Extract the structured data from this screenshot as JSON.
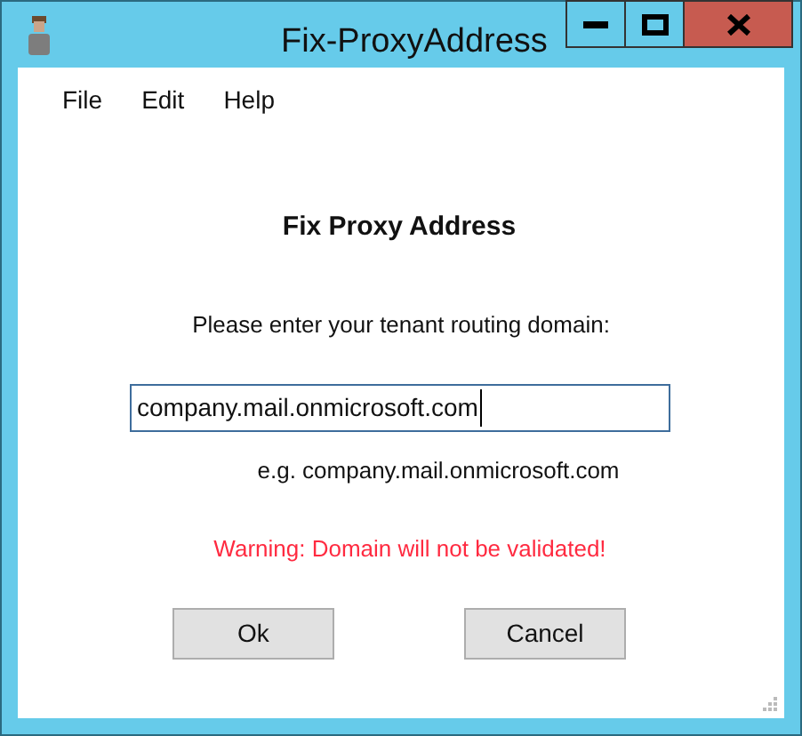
{
  "window": {
    "title": "Fix-ProxyAddress"
  },
  "menu": [
    "File",
    "Edit",
    "Help"
  ],
  "heading": "Fix Proxy Address",
  "prompt": "Please enter your tenant routing domain:",
  "domain_field": {
    "value": "company.mail.onmicrosoft.com"
  },
  "example": "e.g. company.mail.onmicrosoft.com",
  "warning": "Warning: Domain will not be validated!",
  "buttons": [
    "Ok",
    "Cancel"
  ]
}
